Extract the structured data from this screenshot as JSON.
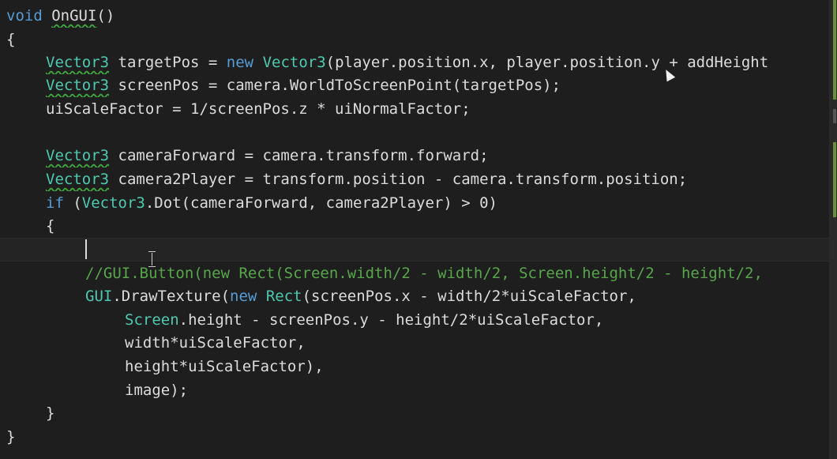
{
  "colors": {
    "background": "#1e1e1e",
    "keyword": "#569cd6",
    "type": "#4ec9b0",
    "comment": "#57a64a",
    "text": "#dcdcdc"
  },
  "code": {
    "l1": {
      "kw": "void",
      "name": "OnGUI",
      "rest": "()"
    },
    "l2": "{",
    "l3": {
      "type1": "Vector3",
      "a": " targetPos = ",
      "kw": "new",
      "sp": " ",
      "type2": "Vector3",
      "b": "(player.position.x, player.position.y + addHeight"
    },
    "l4": {
      "type": "Vector3",
      "a": " screenPos = camera.WorldToScreenPoint(targetPos);"
    },
    "l5": "uiScaleFactor = 1/screenPos.z * uiNormalFactor;",
    "l7": {
      "type": "Vector3",
      "a": " cameraForward = camera.transform.forward;"
    },
    "l8": {
      "type": "Vector3",
      "a": " camera2Player = transform.position - camera.transform.position;"
    },
    "l9": {
      "kw": "if",
      "a": " (",
      "type": "Vector3",
      "b": ".Dot(cameraForward, camera2Player) > 0)"
    },
    "l10": "{",
    "l12": "//GUI.Button(new Rect(Screen.width/2 - width/2, Screen.height/2 - height/2,",
    "l13": {
      "type1": "GUI",
      "a": ".DrawTexture(",
      "kw": "new",
      "sp": " ",
      "type2": "Rect",
      "b": "(screenPos.x - width/2*uiScaleFactor,"
    },
    "l14": {
      "type": "Screen",
      "a": ".height - screenPos.y - height/2*uiScaleFactor,"
    },
    "l15": "width*uiScaleFactor,",
    "l16": "height*uiScaleFactor),",
    "l17": "image);",
    "l18": "}",
    "l19": "}"
  }
}
